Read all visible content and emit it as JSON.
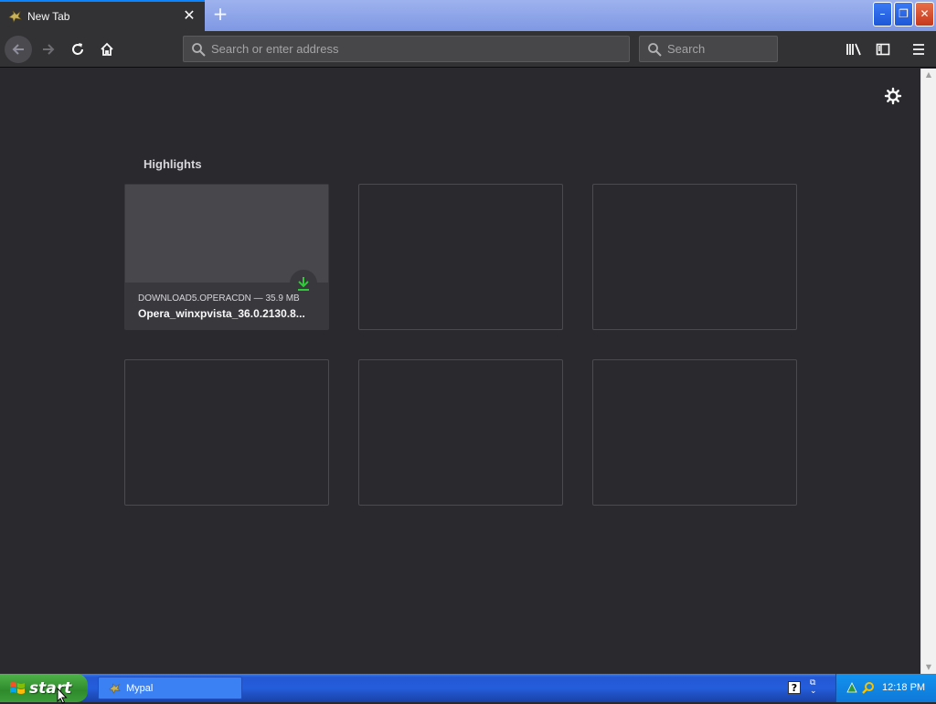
{
  "tab": {
    "title": "New Tab",
    "close": "✕",
    "new_tab": "+"
  },
  "window_buttons": {
    "minimize": "–",
    "restore": "❐",
    "close": "✕"
  },
  "toolbar": {
    "url_placeholder": "Search or enter address",
    "search_placeholder": "Search"
  },
  "content": {
    "section_title": "Highlights",
    "highlights": [
      {
        "context": "DOWNLOAD5.OPERACDN — 35.9 MB",
        "title": "Opera_winxpvista_36.0.2130.8..."
      }
    ]
  },
  "taskbar": {
    "start_label": "start",
    "task_label": "Mypal",
    "help": "?",
    "clock": "12:18 PM"
  },
  "colors": {
    "accent": "#0a84ff",
    "download_green": "#30c93a"
  }
}
